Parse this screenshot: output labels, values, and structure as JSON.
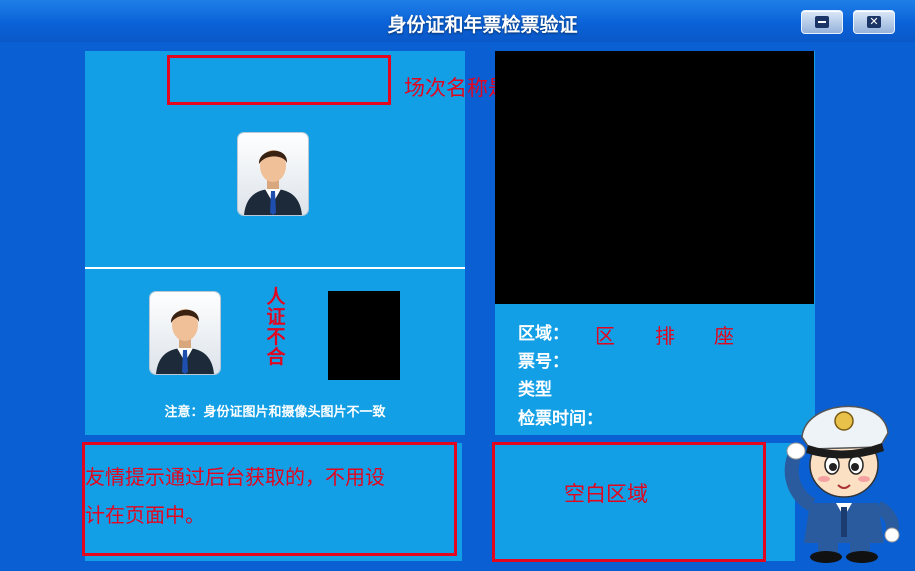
{
  "window": {
    "title": "身份证和年票检票验证",
    "minimize_icon": "minimize-icon",
    "close_icon": "close-icon"
  },
  "left_panel": {
    "session_name_note": "场次名称是后台获取的",
    "verify_result_chars": [
      "人",
      "证",
      "不",
      "合"
    ],
    "warning": "注意：身份证图片和摄像头图片不一致"
  },
  "info": {
    "area_label": "区域：",
    "area_value_zone": "区",
    "area_value_row": "排",
    "area_value_seat": "座",
    "ticket_no_label": "票号：",
    "type_label": "类型",
    "check_time_label": "检票时间："
  },
  "tip": {
    "text_line1": "友情提示通过后台获取的，不用设",
    "text_line2": "计在页面中。"
  },
  "blank": {
    "label": "空白区域"
  },
  "colors": {
    "accent_red": "#e3061f",
    "panel_blue": "#129fe6",
    "background_blue": "#0a5fd3"
  }
}
